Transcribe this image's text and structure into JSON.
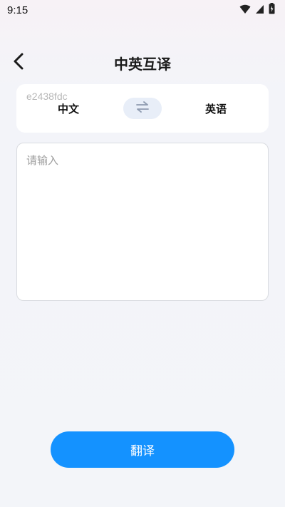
{
  "status_bar": {
    "time": "9:15",
    "icons": [
      "wifi-icon",
      "cellular-icon",
      "battery-icon"
    ]
  },
  "header": {
    "title": "中英互译",
    "back_icon": "chevron-left-icon"
  },
  "language_selector": {
    "code": "e2438fdc",
    "source": "中文",
    "target": "英语",
    "swap_icon": "swap-arrows-icon"
  },
  "input": {
    "placeholder": "请输入",
    "value": ""
  },
  "translate_button": {
    "label": "翻译"
  },
  "colors": {
    "accent": "#1492ff",
    "swap_bg": "#e8eef8",
    "card_bg": "#ffffff"
  }
}
